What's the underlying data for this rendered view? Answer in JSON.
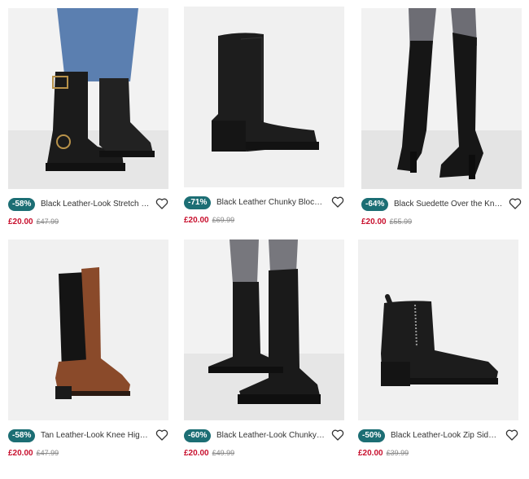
{
  "products": [
    {
      "discount": "-58%",
      "name": "Black Leather-Look Stretch Ca...",
      "price": "£20.00",
      "was_price": "£47.99",
      "image_icon": "knee-high-buckle-boot-image",
      "wishlist_icon": "heart-icon"
    },
    {
      "discount": "-71%",
      "name": "Black Leather Chunky Block H...",
      "price": "£20.00",
      "was_price": "£69.99",
      "image_icon": "chunky-block-heel-boot-image",
      "wishlist_icon": "heart-icon"
    },
    {
      "discount": "-64%",
      "name": "Black Suedette Over the Knee...",
      "price": "£20.00",
      "was_price": "£55.99",
      "image_icon": "over-knee-boot-image",
      "wishlist_icon": "heart-icon"
    },
    {
      "discount": "-58%",
      "name": "Tan Leather-Look Knee High ...",
      "price": "£20.00",
      "was_price": "£47.99",
      "image_icon": "tan-knee-high-boot-image",
      "wishlist_icon": "heart-icon"
    },
    {
      "discount": "-60%",
      "name": "Black Leather-Look Chunky Kn...",
      "price": "£20.00",
      "was_price": "£49.99",
      "image_icon": "chunky-knee-boot-image",
      "wishlist_icon": "heart-icon"
    },
    {
      "discount": "-50%",
      "name": "Black Leather-Look Zip Side C...",
      "price": "£20.00",
      "was_price": "£39.99",
      "image_icon": "zip-ankle-boot-image",
      "wishlist_icon": "heart-icon"
    }
  ],
  "colors": {
    "badge": "#1c6e74",
    "price": "#c8102e",
    "image_bg": "#eeeeee"
  }
}
